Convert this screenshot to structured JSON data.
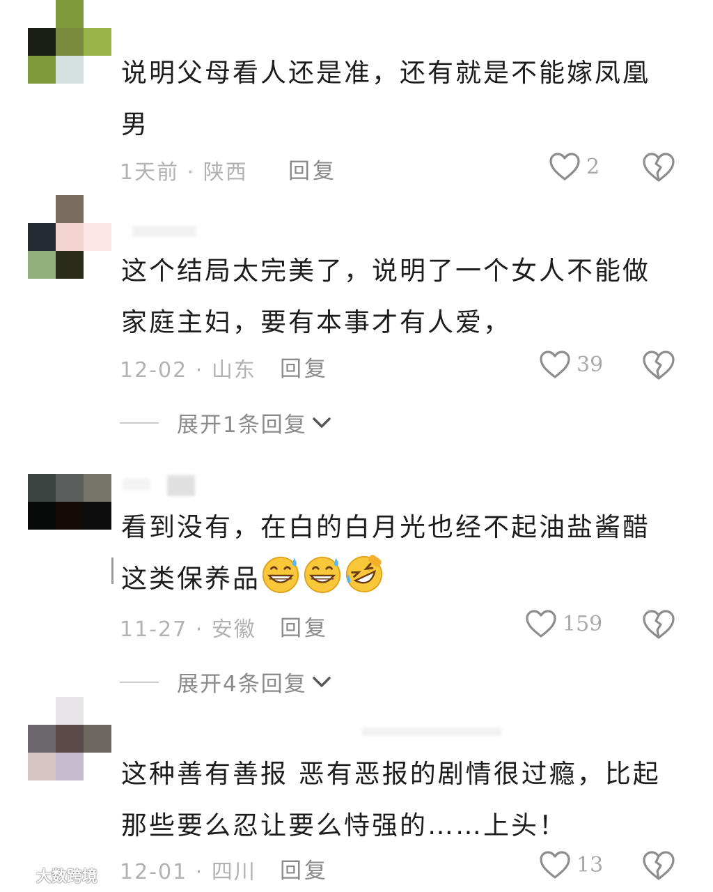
{
  "comments": [
    {
      "text": "说明父母看人还是准，还有就是不能嫁凤凰男",
      "time": "1天前",
      "location": "陕西",
      "reply_label": "回复",
      "likes": "2"
    },
    {
      "text": "这个结局太完美了，说明了一个女人不能做家庭主妇，要有本事才有人爱，",
      "time": "12-02",
      "location": "山东",
      "reply_label": "回复",
      "likes": "39",
      "expand_label": "展开1条回复"
    },
    {
      "text": "看到没有，在白的白月光也经不起油盐酱醋这类保养品",
      "time": "11-27",
      "location": "安徽",
      "reply_label": "回复",
      "likes": "159",
      "expand_label": "展开4条回复",
      "emojis": [
        "grinning-sweat-emoji",
        "grinning-sweat-emoji",
        "rolling-laughing-emoji"
      ]
    },
    {
      "text": "这种善有善报 恶有恶报的剧情很过瘾，比起那些要么忍让要么恃强的……上头！",
      "time": "12-01",
      "location": "四川",
      "reply_label": "回复",
      "likes": "13"
    }
  ],
  "separator": "·",
  "watermark": "大数跨境",
  "colors": {
    "text": "#1c1c1c",
    "meta": "#b2b2b2",
    "icon": "#8c8c8c"
  }
}
